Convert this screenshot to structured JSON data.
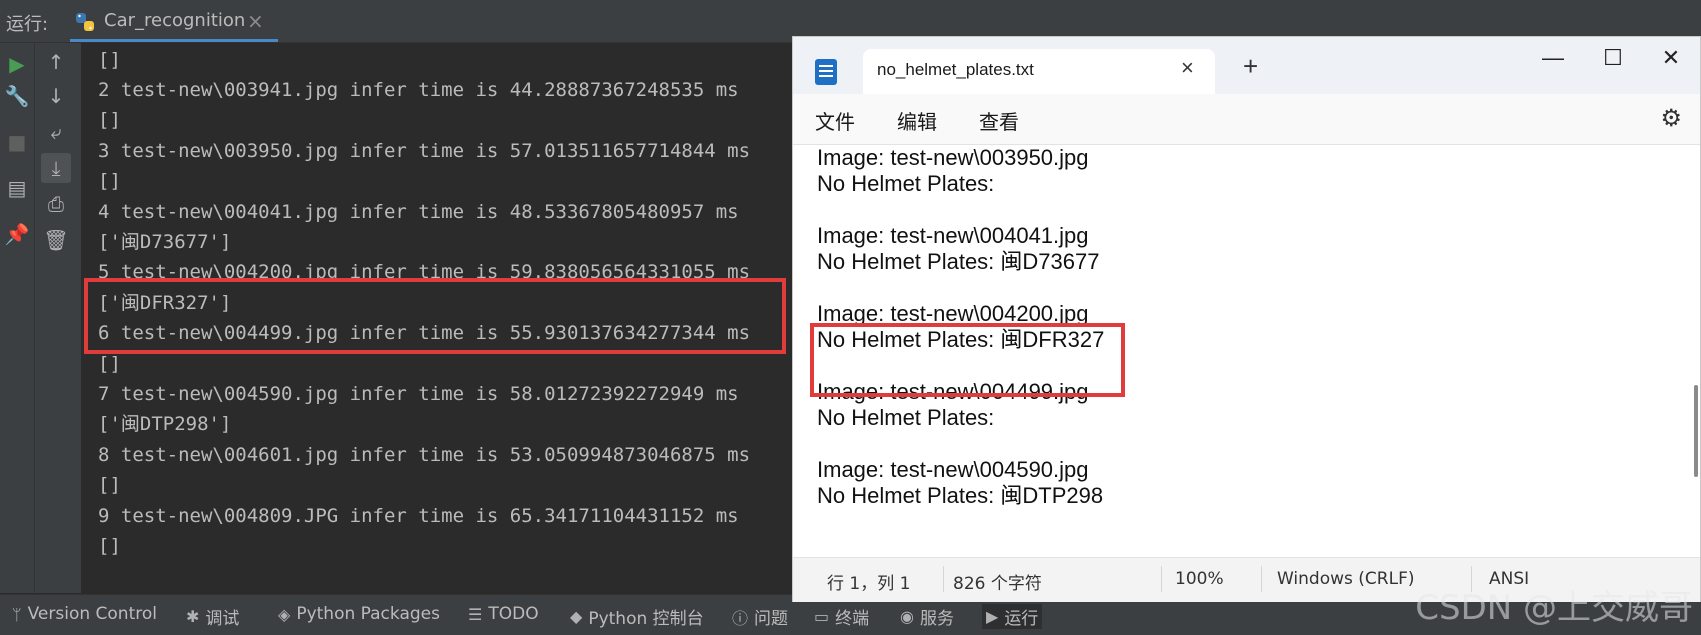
{
  "ide": {
    "run_label": "运行:",
    "run_tab": "Car_recognition",
    "console_lines": [
      "[]",
      "2 test-new\\003941.jpg infer time is 44.28887367248535 ms",
      "[]",
      "3 test-new\\003950.jpg infer time is 57.013511657714844 ms",
      "[]",
      "4 test-new\\004041.jpg infer time is 48.53367805480957 ms",
      "['闽D73677']",
      "5 test-new\\004200.jpg infer time is 59.838056564331055 ms",
      "['闽DFR327']",
      "6 test-new\\004499.jpg infer time is 55.930137634277344 ms",
      "[]",
      "7 test-new\\004590.jpg infer time is 58.01272392272949 ms",
      "['闽DTP298']",
      "8 test-new\\004601.jpg infer time is 53.050994873046875 ms",
      "[]",
      "9 test-new\\004809.JPG infer time is 65.34171104431152 ms",
      "[]"
    ],
    "statusbar": [
      {
        "icon": "branch-icon",
        "label": "Version Control"
      },
      {
        "icon": "bug-icon",
        "label": "调试"
      },
      {
        "icon": "layers-icon",
        "label": "Python Packages"
      },
      {
        "icon": "list-icon",
        "label": "TODO"
      },
      {
        "icon": "python-icon",
        "label": "Python 控制台"
      },
      {
        "icon": "info-icon",
        "label": "问题"
      },
      {
        "icon": "terminal-icon",
        "label": "终端"
      },
      {
        "icon": "services-icon",
        "label": "服务"
      },
      {
        "icon": "play-icon",
        "label": "运行"
      }
    ],
    "watermark": "CSDN @上交威哥"
  },
  "notepad": {
    "tab_title": "no_helmet_plates.txt",
    "menus": [
      "文件",
      "编辑",
      "查看"
    ],
    "lines": [
      "Image: test-new\\003950.jpg",
      "No Helmet Plates:",
      "",
      "Image: test-new\\004041.jpg",
      "No Helmet Plates: 闽D73677",
      "",
      "Image: test-new\\004200.jpg",
      "No Helmet Plates: 闽DFR327",
      "",
      "Image: test-new\\004499.jpg",
      "No Helmet Plates:",
      "",
      "Image: test-new\\004590.jpg",
      "No Helmet Plates: 闽DTP298"
    ],
    "status": {
      "position": "行 1，列 1",
      "chars": "826 个字符",
      "zoom": "100%",
      "eol": "Windows (CRLF)",
      "encoding": "ANSI"
    }
  },
  "colors": {
    "highlight": "#e03c3c",
    "ide_bg": "#2b2b2b",
    "ide_panel": "#3c3f41",
    "run_green": "#499c54"
  }
}
